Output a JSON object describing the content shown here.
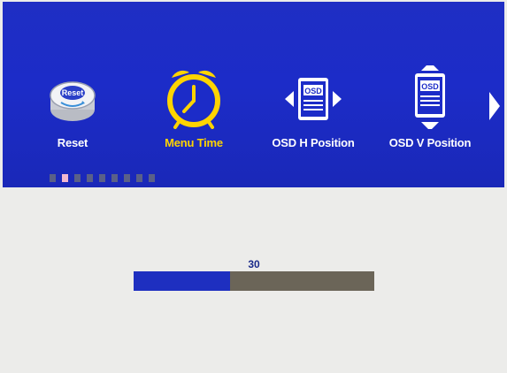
{
  "menu": {
    "items": [
      {
        "label": "Reset",
        "icon": "reset-icon",
        "icon_text": "Reset"
      },
      {
        "label": "Menu Time",
        "icon": "alarm-clock-icon",
        "selected": true
      },
      {
        "label": "OSD H Position",
        "icon": "osd-horizontal-icon",
        "icon_text": "OSD"
      },
      {
        "label": "OSD V Position",
        "icon": "osd-vertical-icon",
        "icon_text": "OSD"
      }
    ],
    "next_icon": "chevron-right-icon",
    "page_dots": {
      "count": 9,
      "active_index": 1
    }
  },
  "setting": {
    "value": "30",
    "fill_fraction": 0.4
  },
  "colors": {
    "menu_background": "#1c2cc8",
    "selected_label": "#ffd400",
    "bar_fill": "#1e2fc0",
    "bar_track": "#6b6558",
    "content_background": "#ececea"
  }
}
